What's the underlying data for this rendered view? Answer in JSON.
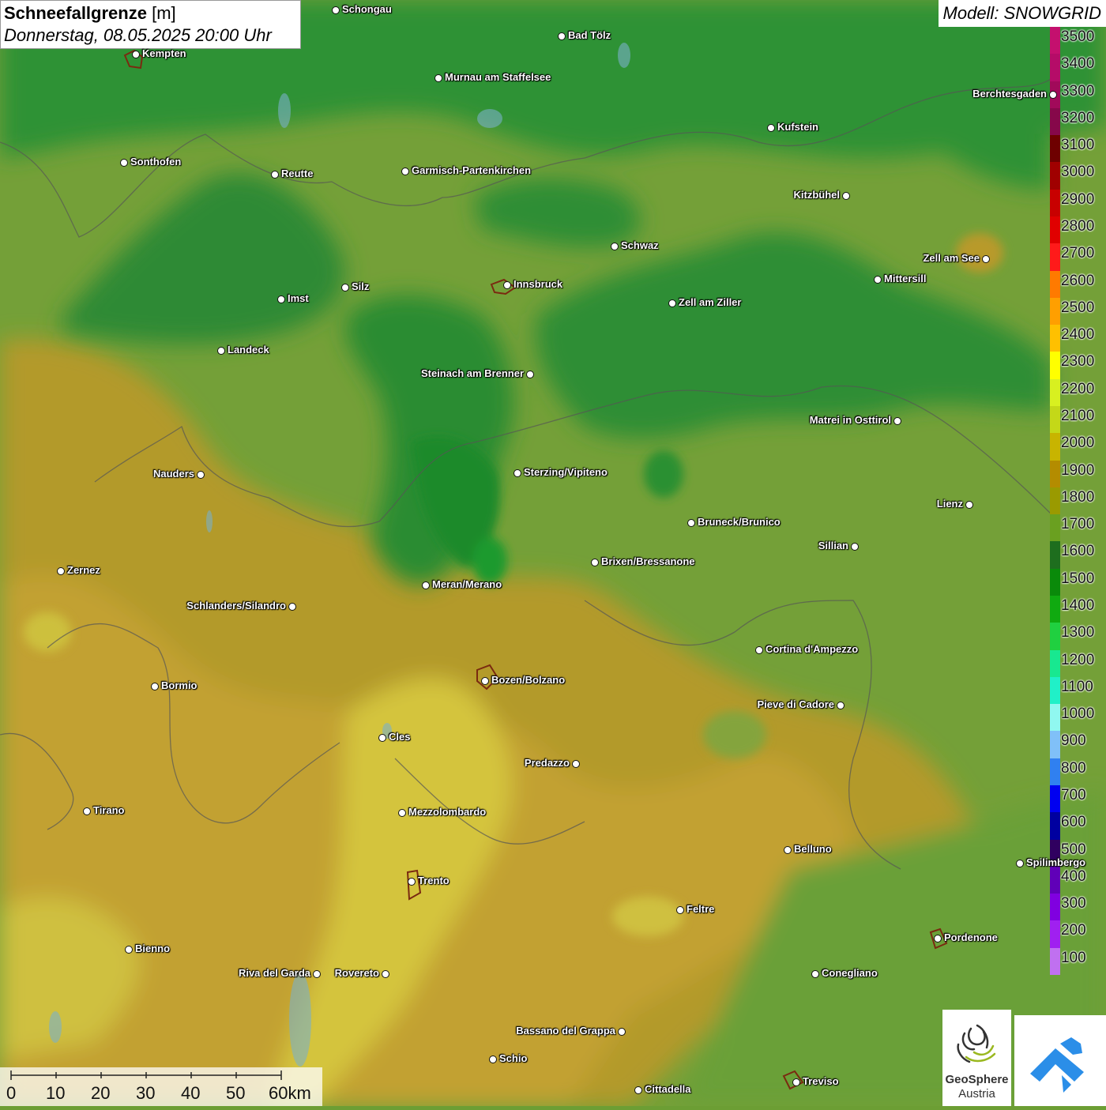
{
  "header": {
    "title_bold": "Schneefallgrenze",
    "title_unit": "[m]",
    "subtitle": "Donnerstag, 08.05.2025 20:00 Uhr",
    "model": "Modell: SNOWGRID"
  },
  "legend": {
    "entries": [
      {
        "value": "3500",
        "color": "#c4106e"
      },
      {
        "value": "3400",
        "color": "#b50c68"
      },
      {
        "value": "3300",
        "color": "#a10a5a"
      },
      {
        "value": "3200",
        "color": "#86084a"
      },
      {
        "value": "3100",
        "color": "#6e0000"
      },
      {
        "value": "3000",
        "color": "#a00000"
      },
      {
        "value": "2900",
        "color": "#c80000"
      },
      {
        "value": "2800",
        "color": "#e00000"
      },
      {
        "value": "2700",
        "color": "#ff1a1a"
      },
      {
        "value": "2600",
        "color": "#ff7a00"
      },
      {
        "value": "2500",
        "color": "#ff9f00"
      },
      {
        "value": "2400",
        "color": "#ffc000"
      },
      {
        "value": "2300",
        "color": "#ffff00"
      },
      {
        "value": "2200",
        "color": "#d8f020"
      },
      {
        "value": "2100",
        "color": "#c4d818"
      },
      {
        "value": "2000",
        "color": "#c8b400"
      },
      {
        "value": "1900",
        "color": "#b48c00"
      },
      {
        "value": "1800",
        "color": "#9a9a00"
      },
      {
        "value": "1700",
        "color": "#6aa020"
      },
      {
        "value": "1600",
        "color": "#1e6e1e"
      },
      {
        "value": "1500",
        "color": "#0a8a0a"
      },
      {
        "value": "1400",
        "color": "#10aa10"
      },
      {
        "value": "1300",
        "color": "#20d040"
      },
      {
        "value": "1200",
        "color": "#18e890"
      },
      {
        "value": "1100",
        "color": "#20f0c8"
      },
      {
        "value": "1000",
        "color": "#90f8f0"
      },
      {
        "value": "900",
        "color": "#80c0f8"
      },
      {
        "value": "800",
        "color": "#3080f0"
      },
      {
        "value": "700",
        "color": "#0000f0"
      },
      {
        "value": "600",
        "color": "#0000a0"
      },
      {
        "value": "500",
        "color": "#300060"
      },
      {
        "value": "400",
        "color": "#6000b8"
      },
      {
        "value": "300",
        "color": "#8000e0"
      },
      {
        "value": "200",
        "color": "#a020f0"
      },
      {
        "value": "100",
        "color": "#c070f0"
      }
    ]
  },
  "places": [
    {
      "name": "Schongau",
      "side": "right"
    },
    {
      "name": "Bad Tölz",
      "side": "right"
    },
    {
      "name": "Kempten",
      "side": "right"
    },
    {
      "name": "Murnau am Staffelsee",
      "side": "right"
    },
    {
      "name": "Berchtesgaden",
      "side": "left"
    },
    {
      "name": "Kufstein",
      "side": "right"
    },
    {
      "name": "Sonthofen",
      "side": "right"
    },
    {
      "name": "Reutte",
      "side": "right"
    },
    {
      "name": "Garmisch-Partenkirchen",
      "side": "right"
    },
    {
      "name": "Kitzbühel",
      "side": "left"
    },
    {
      "name": "Schwaz",
      "side": "right"
    },
    {
      "name": "Zell am See",
      "side": "left"
    },
    {
      "name": "Mittersill",
      "side": "right"
    },
    {
      "name": "Innsbruck",
      "side": "right"
    },
    {
      "name": "Silz",
      "side": "right"
    },
    {
      "name": "Imst",
      "side": "right"
    },
    {
      "name": "Zell am Ziller",
      "side": "right"
    },
    {
      "name": "Landeck",
      "side": "right"
    },
    {
      "name": "Steinach am Brenner",
      "side": "left"
    },
    {
      "name": "Matrei in Osttirol",
      "side": "left"
    },
    {
      "name": "Nauders",
      "side": "left"
    },
    {
      "name": "Sterzing/Vipiteno",
      "side": "right"
    },
    {
      "name": "Lienz",
      "side": "left"
    },
    {
      "name": "Bruneck/Brunico",
      "side": "right"
    },
    {
      "name": "Sillian",
      "side": "left"
    },
    {
      "name": "Zernez",
      "side": "right"
    },
    {
      "name": "Brixen/Bressanone",
      "side": "right"
    },
    {
      "name": "Meran/Merano",
      "side": "right"
    },
    {
      "name": "Schlanders/Silandro",
      "side": "left"
    },
    {
      "name": "Cortina d'Ampezzo",
      "side": "right"
    },
    {
      "name": "Bormio",
      "side": "right"
    },
    {
      "name": "Bozen/Bolzano",
      "side": "right"
    },
    {
      "name": "Pieve di Cadore",
      "side": "left"
    },
    {
      "name": "Cles",
      "side": "right"
    },
    {
      "name": "Predazzo",
      "side": "left"
    },
    {
      "name": "Tirano",
      "side": "right"
    },
    {
      "name": "Mezzolombardo",
      "side": "right"
    },
    {
      "name": "Belluno",
      "side": "right"
    },
    {
      "name": "Spilimbergo",
      "side": "right"
    },
    {
      "name": "Trento",
      "side": "right"
    },
    {
      "name": "Feltre",
      "side": "right"
    },
    {
      "name": "Pordenone",
      "side": "right"
    },
    {
      "name": "Bienno",
      "side": "right"
    },
    {
      "name": "Riva del Garda",
      "side": "left"
    },
    {
      "name": "Rovereto",
      "side": "left"
    },
    {
      "name": "Conegliano",
      "side": "right"
    },
    {
      "name": "Bassano del Grappa",
      "side": "left"
    },
    {
      "name": "Schio",
      "side": "right"
    },
    {
      "name": "Treviso",
      "side": "right"
    },
    {
      "name": "Cittadella",
      "side": "right"
    }
  ],
  "scalebar": {
    "labels": [
      "0",
      "10",
      "20",
      "30",
      "40",
      "50",
      "60km"
    ]
  },
  "logos": {
    "geosphere_line1": "GeoSphere",
    "geosphere_line2": "Austria"
  }
}
